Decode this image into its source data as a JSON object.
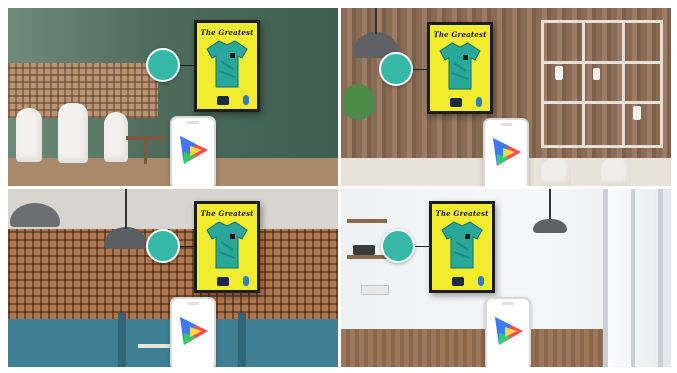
{
  "poster_title": "The Greatest",
  "colors": {
    "poster_yellow": "#f2ec2f",
    "jersey_teal": "#2aa79b",
    "callout_teal": "#35b8a6"
  },
  "icons": [
    "jersey-icon",
    "color-gamut-icon"
  ]
}
